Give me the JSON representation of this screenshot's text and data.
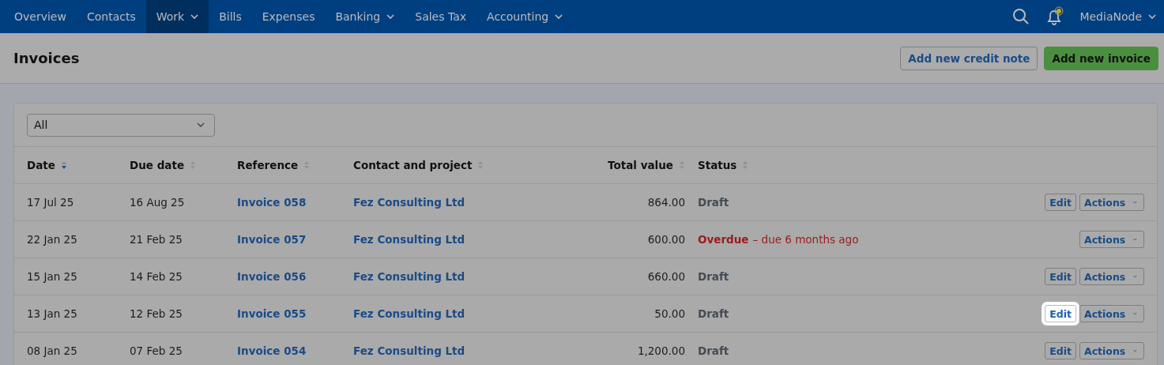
{
  "nav": {
    "items": [
      {
        "label": "Overview",
        "selected": false,
        "dropdown": false
      },
      {
        "label": "Contacts",
        "selected": false,
        "dropdown": false
      },
      {
        "label": "Work",
        "selected": true,
        "dropdown": true
      },
      {
        "label": "Bills",
        "selected": false,
        "dropdown": false
      },
      {
        "label": "Expenses",
        "selected": false,
        "dropdown": false
      },
      {
        "label": "Banking",
        "selected": false,
        "dropdown": true
      },
      {
        "label": "Sales Tax",
        "selected": false,
        "dropdown": false
      },
      {
        "label": "Accounting",
        "selected": false,
        "dropdown": true
      }
    ],
    "account": "MediaNode",
    "notification": true
  },
  "page": {
    "title": "Invoices",
    "buttons": [
      {
        "label": "Add new credit note",
        "kind": "secondary"
      },
      {
        "label": "Add new invoice",
        "kind": "primary"
      }
    ]
  },
  "filter": {
    "value": "All"
  },
  "table": {
    "columns": [
      {
        "label": "Date",
        "sorted": true
      },
      {
        "label": "Due date",
        "sorted": false
      },
      {
        "label": "Reference",
        "sorted": false
      },
      {
        "label": "Contact and project",
        "sorted": false
      },
      {
        "label": "Total value",
        "sorted": false
      },
      {
        "label": "Status",
        "sorted": false
      }
    ],
    "rows": [
      {
        "date": "17 Jul 25",
        "due": "16 Aug 25",
        "reference": "Invoice 058",
        "contact": "Fez Consulting Ltd",
        "total": "864.00",
        "status": "Draft",
        "overdue": false,
        "edit": "Edit",
        "editable": true,
        "edit_highlighted": false,
        "actions": "Actions"
      },
      {
        "date": "22 Jan 25",
        "due": "21 Feb 25",
        "reference": "Invoice 057",
        "contact": "Fez Consulting Ltd",
        "total": "600.00",
        "status": "Overdue",
        "overdue": true,
        "status_note": "– due 6 months ago",
        "editable": false,
        "actions": "Actions"
      },
      {
        "date": "15 Jan 25",
        "due": "14 Feb 25",
        "reference": "Invoice 056",
        "contact": "Fez Consulting Ltd",
        "total": "660.00",
        "status": "Draft",
        "overdue": false,
        "edit": "Edit",
        "editable": true,
        "edit_highlighted": false,
        "actions": "Actions"
      },
      {
        "date": "13 Jan 25",
        "due": "12 Feb 25",
        "reference": "Invoice 055",
        "contact": "Fez Consulting Ltd",
        "total": "50.00",
        "status": "Draft",
        "overdue": false,
        "edit": "Edit",
        "editable": true,
        "edit_highlighted": true,
        "actions": "Actions"
      },
      {
        "date": "08 Jan 25",
        "due": "07 Feb 25",
        "reference": "Invoice 054",
        "contact": "Fez Consulting Ltd",
        "total": "1,200.00",
        "status": "Draft",
        "overdue": false,
        "edit": "Edit",
        "editable": true,
        "edit_highlighted": false,
        "actions": "Actions"
      }
    ]
  }
}
